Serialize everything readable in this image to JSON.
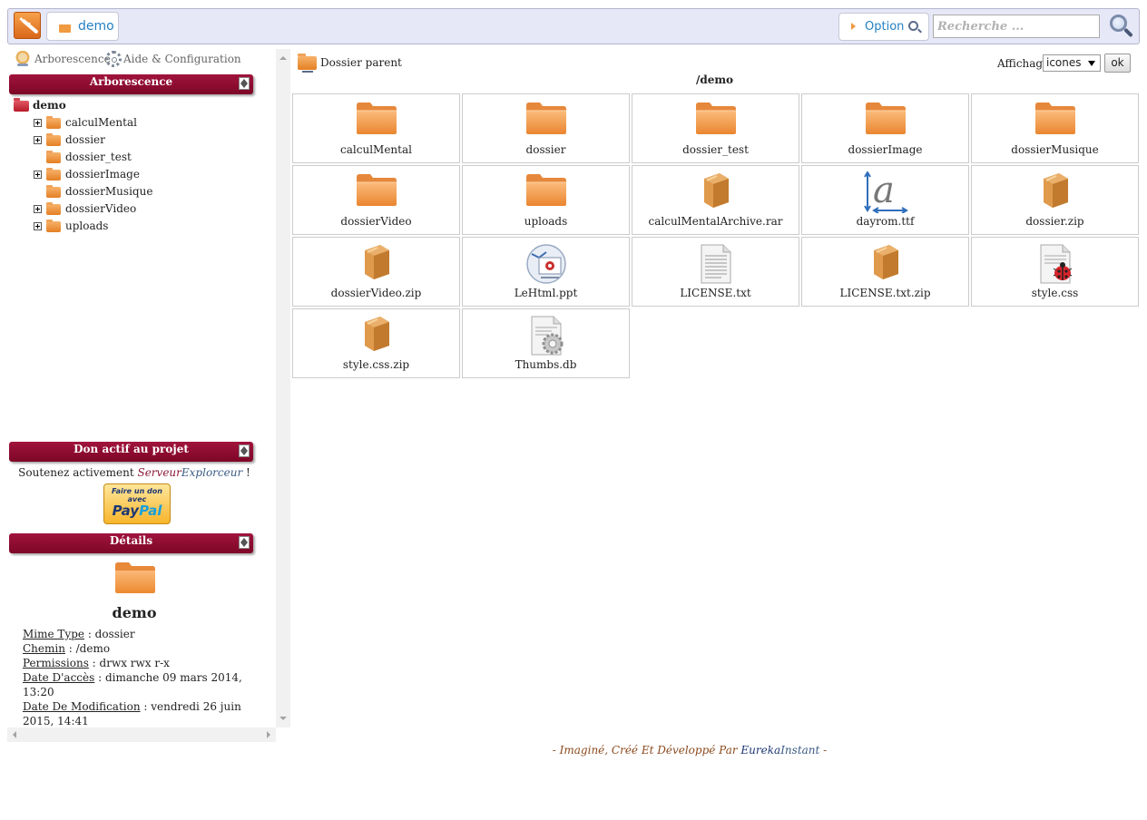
{
  "header": {
    "breadcrumb_label": "demo",
    "option_label": "Option",
    "search_placeholder": "Recherche ..."
  },
  "sidebar": {
    "tabs": [
      {
        "label": "Arborescence",
        "icon": "tree-icon"
      },
      {
        "label": "Aide & Configuration",
        "icon": "gear-icon"
      }
    ],
    "tree_panel_title": "Arborescence",
    "tree": {
      "root": "demo",
      "items": [
        {
          "label": "calculMental",
          "expandable": true
        },
        {
          "label": "dossier",
          "expandable": true
        },
        {
          "label": "dossier_test",
          "expandable": false
        },
        {
          "label": "dossierImage",
          "expandable": true
        },
        {
          "label": "dossierMusique",
          "expandable": false
        },
        {
          "label": "dossierVideo",
          "expandable": true
        },
        {
          "label": "uploads",
          "expandable": true
        }
      ]
    },
    "donate_panel_title": "Don actif au projet",
    "donate_text_prefix": "Soutenez activement ",
    "donate_brand_a": "Serveur",
    "donate_brand_b": "Explorceur",
    "donate_text_suffix": " !",
    "paypal_small": "Faire un don avec",
    "paypal_big_a": "Pay",
    "paypal_big_b": "Pal",
    "details_panel_title": "Détails",
    "details": {
      "name": "demo",
      "rows": [
        {
          "key": "Mime Type",
          "value": " : dossier"
        },
        {
          "key": "Chemin",
          "value": " : /demo"
        },
        {
          "key": "Permissions",
          "value": " : drwx rwx r-x"
        },
        {
          "key": "Date D'accès",
          "value": " : dimanche 09 mars 2014, 13:20"
        },
        {
          "key": "Date De Modification",
          "value": " : vendredi 26 juin 2015, 14:41"
        }
      ]
    }
  },
  "main": {
    "parent_link": "Dossier parent",
    "current_path": "/demo",
    "view_label": "Affichage",
    "view_selected": "icones",
    "ok_label": "ok",
    "files": [
      {
        "name": "calculMental",
        "icon": "folder-icon"
      },
      {
        "name": "dossier",
        "icon": "folder-icon"
      },
      {
        "name": "dossier_test",
        "icon": "folder-icon"
      },
      {
        "name": "dossierImage",
        "icon": "folder-icon"
      },
      {
        "name": "dossierMusique",
        "icon": "folder-icon"
      },
      {
        "name": "dossierVideo",
        "icon": "folder-icon"
      },
      {
        "name": "uploads",
        "icon": "folder-icon"
      },
      {
        "name": "calculMentalArchive.rar",
        "icon": "archive-icon"
      },
      {
        "name": "dayrom.ttf",
        "icon": "font-icon"
      },
      {
        "name": "dossier.zip",
        "icon": "archive-icon"
      },
      {
        "name": "dossierVideo.zip",
        "icon": "archive-icon"
      },
      {
        "name": "LeHtml.ppt",
        "icon": "presentation-icon"
      },
      {
        "name": "LICENSE.txt",
        "icon": "text-file-icon"
      },
      {
        "name": "LICENSE.txt.zip",
        "icon": "archive-icon"
      },
      {
        "name": "style.css",
        "icon": "css-file-icon"
      },
      {
        "name": "style.css.zip",
        "icon": "archive-icon"
      },
      {
        "name": "Thumbs.db",
        "icon": "system-file-icon"
      }
    ]
  },
  "footer": {
    "prefix": "- Imaginé, Créé Et Développé Par ",
    "brand_a": "Eureka",
    "brand_b": "Instant",
    "suffix": " -"
  },
  "colors": {
    "accent_blue": "#2480c2",
    "panel_header": "#8c0c30",
    "folder_orange": "#f09a41",
    "topbar_bg": "#e6e7f7"
  }
}
